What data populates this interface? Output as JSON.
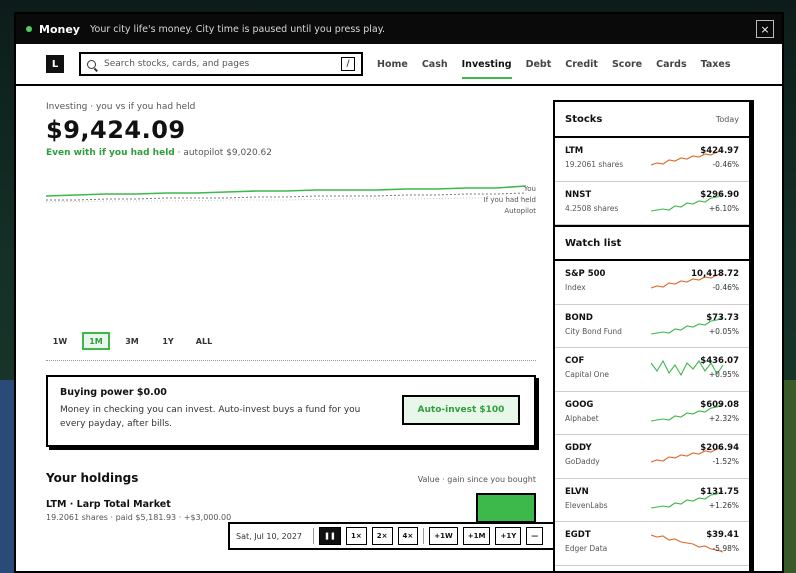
{
  "titlebar": {
    "app": "Money",
    "subtitle": "Your city life's money. City time is paused until you press play.",
    "close": "×"
  },
  "nav": {
    "logo": "L",
    "search_placeholder": "Search stocks, cards, and pages",
    "shortcut": "/",
    "links": [
      "Home",
      "Cash",
      "Investing",
      "Debt",
      "Credit",
      "Score",
      "Cards",
      "Taxes"
    ],
    "active": "Investing"
  },
  "main": {
    "breadcrumb": "Investing · you vs if you had held",
    "value": "$9,424.09",
    "gain_green": "Even with if you had held",
    "gain_rest": "· autopilot $9,020.62",
    "legend": [
      "You",
      "If you had held",
      "Autopilot"
    ],
    "ranges": [
      "1W",
      "1M",
      "3M",
      "1Y",
      "ALL"
    ],
    "active_range": "1M",
    "buying_power": {
      "title": "Buying power $0.00",
      "desc": "Money in checking you can invest. Auto-invest buys a fund for you every payday, after bills.",
      "button": "Auto-invest $100"
    },
    "holdings": {
      "title": "Your holdings",
      "subtitle": "Value · gain since you bought",
      "rows": [
        {
          "name": "LTM · Larp Total Market",
          "detail": "19.2061 shares · paid $5,181.93 · +$3,000.00"
        }
      ]
    }
  },
  "timebar": {
    "date": "Sat, Jul 10, 2027",
    "pause": "❚❚",
    "speeds": [
      "1×",
      "2×",
      "4×"
    ],
    "jumps": [
      "+1W",
      "+1M",
      "+1Y"
    ],
    "minimize": "—"
  },
  "stocks": {
    "title": "Stocks",
    "tag": "Today",
    "items": [
      {
        "ticker": "LTM",
        "sub": "19.2061 shares",
        "price": "$424.97",
        "change": "-0.46%",
        "trend": "up-orange"
      },
      {
        "ticker": "NNST",
        "sub": "4.2508 shares",
        "price": "$296.90",
        "change": "+6.10%",
        "trend": "up-green"
      }
    ]
  },
  "watchlist": {
    "title": "Watch list",
    "items": [
      {
        "ticker": "S&P 500",
        "sub": "Index",
        "price": "10,418.72",
        "change": "-0.46%",
        "trend": "up-orange"
      },
      {
        "ticker": "BOND",
        "sub": "City Bond Fund",
        "price": "$73.73",
        "change": "+0.05%",
        "trend": "up-green"
      },
      {
        "ticker": "COF",
        "sub": "Capital One",
        "price": "$436.07",
        "change": "+0.95%",
        "trend": "volatile-green"
      },
      {
        "ticker": "GOOG",
        "sub": "Alphabet",
        "price": "$609.08",
        "change": "+2.32%",
        "trend": "up-green"
      },
      {
        "ticker": "GDDY",
        "sub": "GoDaddy",
        "price": "$206.94",
        "change": "-1.52%",
        "trend": "up-orange"
      },
      {
        "ticker": "ELVN",
        "sub": "ElevenLabs",
        "price": "$131.75",
        "change": "+1.26%",
        "trend": "up-green"
      },
      {
        "ticker": "EGDT",
        "sub": "Edger Data",
        "price": "$39.41",
        "change": "-5.98%",
        "trend": "down-orange"
      }
    ]
  },
  "colors": {
    "accent_green": "#3db84a",
    "negative_orange": "#e06a2c",
    "ink": "#111111"
  }
}
